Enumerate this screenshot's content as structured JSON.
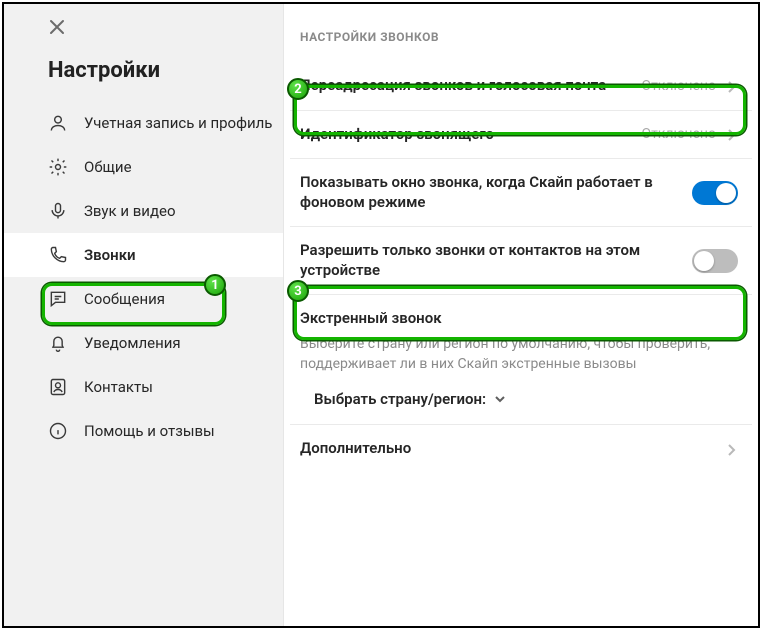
{
  "sidebar": {
    "title": "Настройки",
    "items": [
      {
        "label": "Учетная запись и профиль",
        "icon": "user-icon"
      },
      {
        "label": "Общие",
        "icon": "gear-icon"
      },
      {
        "label": "Звук и видео",
        "icon": "mic-icon"
      },
      {
        "label": "Звонки",
        "icon": "phone-icon",
        "active": true
      },
      {
        "label": "Сообщения",
        "icon": "chat-icon"
      },
      {
        "label": "Уведомления",
        "icon": "bell-icon"
      },
      {
        "label": "Контакты",
        "icon": "contacts-icon"
      },
      {
        "label": "Помощь и отзывы",
        "icon": "info-icon"
      }
    ]
  },
  "main": {
    "section_title": "НАСТРОЙКИ ЗВОНКОВ",
    "rows": {
      "forwarding": {
        "label": "Переадресация звонков и голосовая почта",
        "status": "Отключено"
      },
      "caller_id": {
        "label": "Идентификатор звонящего",
        "status": "Отключено"
      },
      "show_window": {
        "label": "Показывать окно звонка, когда Скайп работает в фоновом режиме",
        "on": true
      },
      "contacts_only": {
        "label": "Разрешить только звонки от контактов на этом устройстве",
        "on": false
      }
    },
    "emergency": {
      "title": "Экстренный звонок",
      "desc": "Выберите страну или регион по умолчанию, чтобы проверить, поддерживает ли в них Скайп экстренные вызовы",
      "select_label": "Выбрать страну/регион:"
    },
    "more": {
      "label": "Дополнительно"
    }
  },
  "annotations": {
    "1": "1",
    "2": "2",
    "3": "3"
  }
}
